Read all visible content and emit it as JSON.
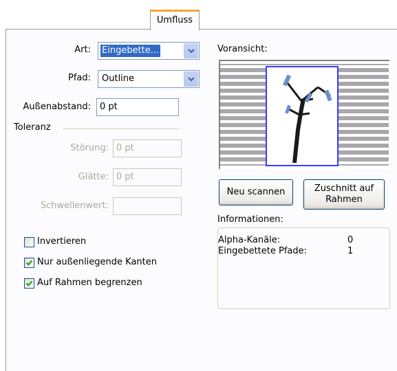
{
  "tab": {
    "label": "Umfluss"
  },
  "form": {
    "art_label": "Art:",
    "art_value": "Eingebette...",
    "pfad_label": "Pfad:",
    "pfad_value": "Outline",
    "aussenabstand_label": "Außenabstand:",
    "aussenabstand_value": "0 pt",
    "toleranz_label": "Toleranz",
    "stoerung_label": "Störung:",
    "stoerung_value": "0 pt",
    "glaette_label": "Glätte:",
    "glaette_value": "0 pt",
    "schwellenwert_label": "Schwellenwert:",
    "schwellenwert_value": ""
  },
  "checkboxes": [
    {
      "label": "Invertieren",
      "checked": false
    },
    {
      "label": "Nur außenliegende Kanten",
      "checked": true
    },
    {
      "label": "Auf Rahmen begrenzen",
      "checked": true
    }
  ],
  "preview": {
    "label": "Voransicht:"
  },
  "buttons": {
    "rescan": "Neu scannen",
    "crop_line1": "Zuschnitt auf",
    "crop_line2": "Rahmen"
  },
  "info": {
    "label": "Informationen:",
    "rows": [
      {
        "key": "Alpha-Kanäle:",
        "value": "0"
      },
      {
        "key": "Eingebettete Pfade:",
        "value": "1"
      }
    ]
  },
  "colors": {
    "tab_accent": "#f7a630",
    "selection": "#316ac5",
    "frame_blue": "#3a3aff"
  }
}
